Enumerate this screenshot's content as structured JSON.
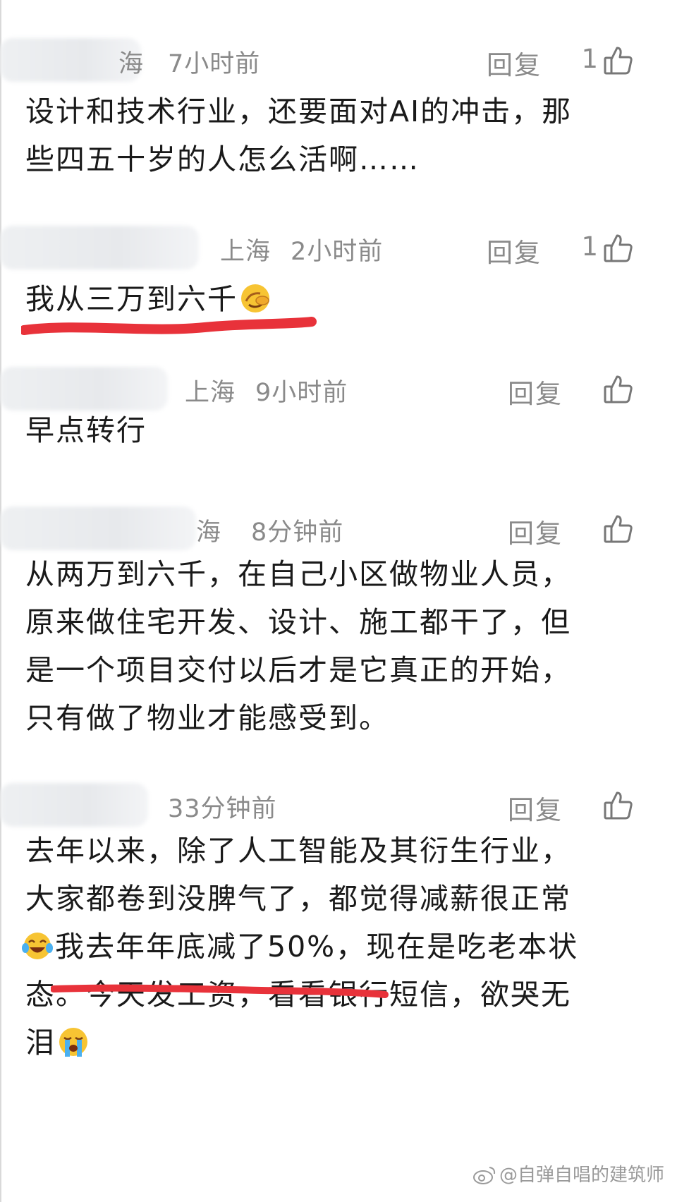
{
  "comments": [
    {
      "location": "海",
      "time": "7小时前",
      "reply": "回复",
      "likes": "1",
      "lines": [
        "设计和技术行业，还要面对AI的冲击，那",
        "些四五十岁的人怎么活啊……"
      ]
    },
    {
      "location": "上海",
      "time": "2小时前",
      "reply": "回复",
      "likes": "1",
      "lines": [
        "我从三万到六千"
      ]
    },
    {
      "location": "上海",
      "time": "9小时前",
      "reply": "回复",
      "lines": [
        "早点转行"
      ]
    },
    {
      "location": "海",
      "time": "8分钟前",
      "reply": "回复",
      "lines": [
        "从两万到六千，在自己小区做物业人员，",
        "原来做住宅开发、设计、施工都干了，但",
        "是一个项目交付以后才是它真正的开始，",
        "只有做了物业才能感受到。"
      ]
    },
    {
      "time": "33分钟前",
      "reply": "回复",
      "lines": [
        "去年以来，除了人工智能及其衍生行业，",
        "大家都卷到没脾气了，都觉得减薪很正常",
        "我去年年底减了50%，现在是吃老本状",
        "态。今天发工资，看看银行短信，欲哭无",
        "泪"
      ]
    }
  ],
  "watermark": "@自弹自唱的建筑师",
  "icons": {
    "like": "thumbs-up-icon",
    "emoji_facepalm": "facepalm-emoji-icon",
    "emoji_laugh": "tears-of-joy-emoji-icon",
    "emoji_cry": "loudly-crying-emoji-icon",
    "weibo": "weibo-logo-icon"
  },
  "colors": {
    "underline": "#e8323a",
    "meta": "#8a8a8a"
  }
}
